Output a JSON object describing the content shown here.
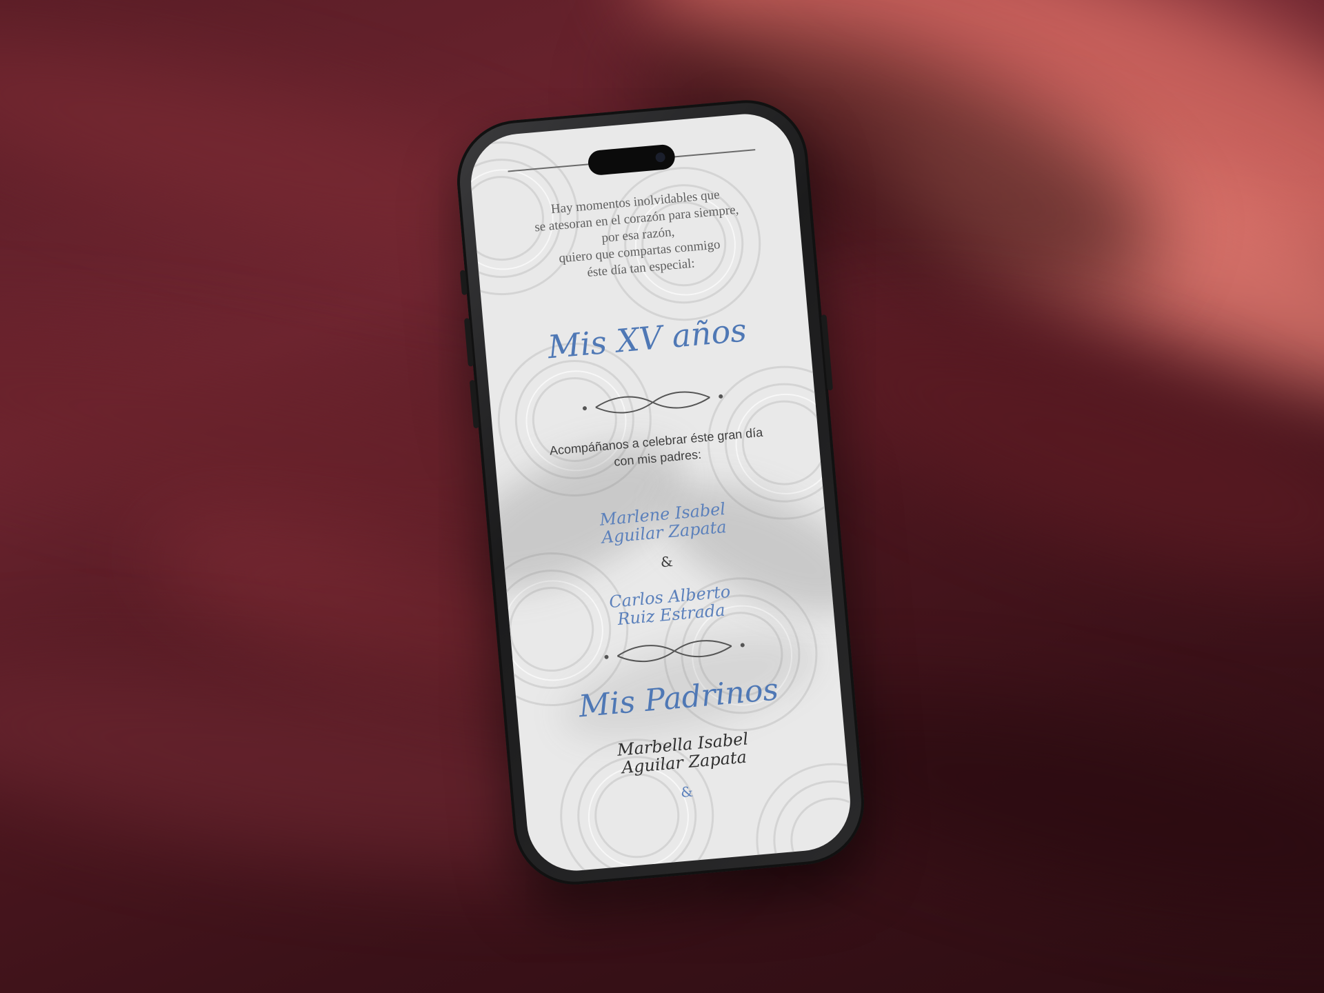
{
  "invitation": {
    "intro_lines": [
      "Hay momentos inolvidables que",
      "se atesoran en el corazón para siempre,",
      "por esa razón,",
      "quiero que compartas conmigo",
      "éste día tan especial:"
    ],
    "title": "Mis XV años",
    "celebrate_lines": [
      "Acompáñanos a celebrar éste gran día",
      "con mis padres:"
    ],
    "parent_1_lines": [
      "Marlene Isabel",
      "Aguilar Zapata"
    ],
    "ampersand": "&",
    "parent_2_lines": [
      "Carlos Alberto",
      "Ruiz Estrada"
    ],
    "padrinos_title": "Mis Padrinos",
    "padrino_1_lines": [
      "Marbella Isabel",
      "Aguilar Zapata"
    ],
    "ampersand_2": "&"
  },
  "colors": {
    "accent_blue": "#4f78b5",
    "text_gray": "#5f5f5f",
    "screen_bg": "#e9e9e9",
    "background_fabric": "#6e2530"
  }
}
